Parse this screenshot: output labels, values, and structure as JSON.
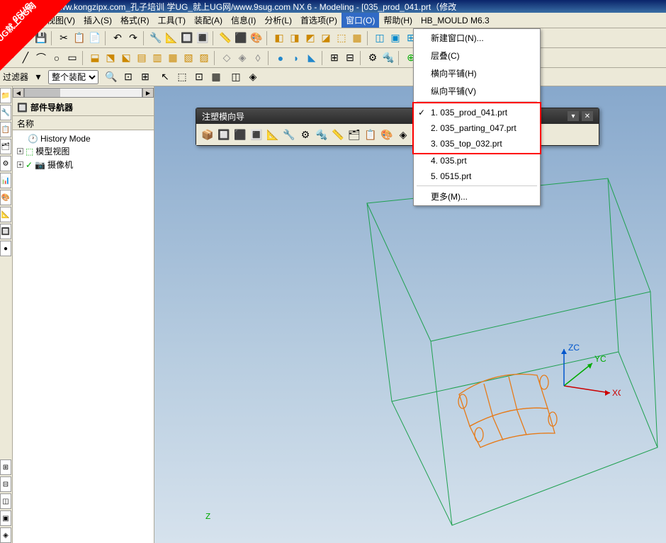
{
  "title": "训/www.kongzipx.com_孔子培训  学UG_就上UG网/www.9sug.com  NX 6 - Modeling - [035_prod_041.prt（修改",
  "watermark": {
    "top": "9SUG",
    "bottom": "学UG就上UG网"
  },
  "menu": {
    "view": "视图(V)",
    "insert": "插入(S)",
    "format": "格式(R)",
    "tools": "工具(T)",
    "assemblies": "装配(A)",
    "info": "信息(I)",
    "analysis": "分析(L)",
    "preferences": "首选项(P)",
    "window": "窗口(O)",
    "help": "帮助(H)",
    "hb_mould": "HB_MOULD M6.3"
  },
  "dropdown": {
    "new_window": "新建窗口(N)...",
    "cascade": "层叠(C)",
    "tile_h": "横向平铺(H)",
    "tile_v": "纵向平铺(V)",
    "w1": "1. 035_prod_041.prt",
    "w2": "2. 035_parting_047.prt",
    "w3": "3. 035_top_032.prt",
    "w4": "4. 035.prt",
    "w5": "5. 0515.prt",
    "more": "更多(M)..."
  },
  "filter": {
    "label": "过滤器",
    "assembly": "整个装配"
  },
  "nav": {
    "title": "部件导航器",
    "col_name": "名称",
    "history": "History Mode",
    "model_view": "模型视图",
    "camera": "摄像机"
  },
  "floatbar": {
    "title": "注塑模向导"
  },
  "triad": {
    "x": "XC",
    "y": "YC",
    "z": "ZC"
  },
  "zlabel": "Z"
}
